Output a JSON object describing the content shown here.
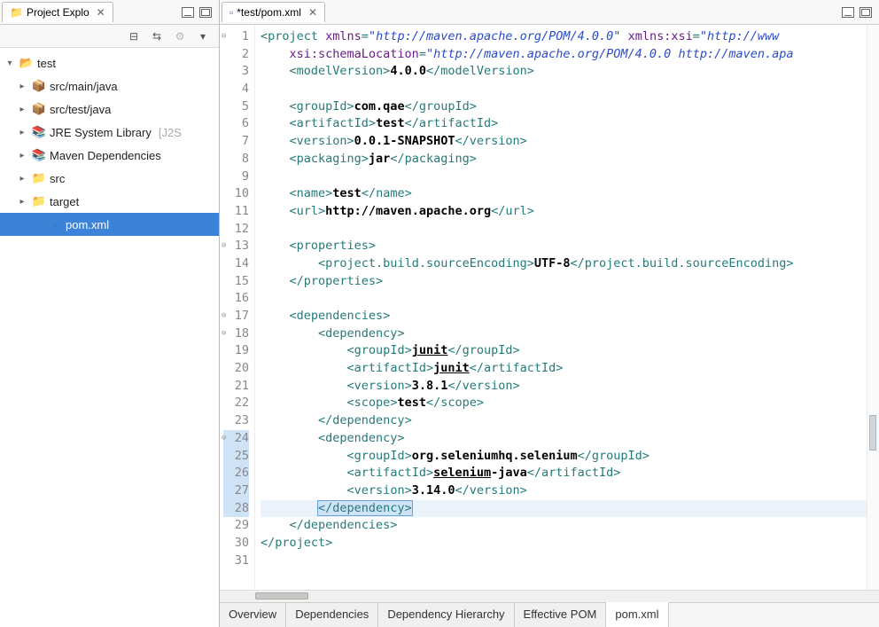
{
  "explorer": {
    "title": "Project Explo",
    "toolbar": [
      "collapse-all-icon",
      "link-icon",
      "filter-icon",
      "menu-icon"
    ],
    "tree": [
      {
        "depth": 0,
        "exp": "▾",
        "icon": "proj",
        "label": "test"
      },
      {
        "depth": 1,
        "exp": "▸",
        "icon": "pkg",
        "label": "src/main/java"
      },
      {
        "depth": 1,
        "exp": "▸",
        "icon": "pkg",
        "label": "src/test/java"
      },
      {
        "depth": 1,
        "exp": "▸",
        "icon": "lib",
        "label": "JRE System Library",
        "extra": "[J2S"
      },
      {
        "depth": 1,
        "exp": "▸",
        "icon": "lib",
        "label": "Maven Dependencies"
      },
      {
        "depth": 1,
        "exp": "▸",
        "icon": "folder",
        "label": "src"
      },
      {
        "depth": 1,
        "exp": "▸",
        "icon": "folder",
        "label": "target"
      },
      {
        "depth": 2,
        "exp": "",
        "icon": "file",
        "label": "pom.xml",
        "selected": true
      }
    ]
  },
  "editor": {
    "tab_title": "*test/pom.xml",
    "lines": [
      {
        "n": 1,
        "fold": true,
        "segs": [
          [
            "t-tag",
            "<project "
          ],
          [
            "t-attr",
            "xmlns"
          ],
          [
            "t-tag",
            "="
          ],
          [
            "t-str",
            "\"http://maven.apache.org/POM/4.0.0\""
          ],
          [
            "t-tag",
            " "
          ],
          [
            "t-attr",
            "xmlns:xsi"
          ],
          [
            "t-tag",
            "="
          ],
          [
            "t-str",
            "\"http://www"
          ]
        ]
      },
      {
        "n": 2,
        "segs": [
          [
            "",
            "    "
          ],
          [
            "t-attr",
            "xsi:schemaLocation"
          ],
          [
            "t-tag",
            "="
          ],
          [
            "t-str",
            "\"http://maven.apache.org/POM/4.0.0 http://maven.apa"
          ]
        ]
      },
      {
        "n": 3,
        "segs": [
          [
            "",
            "    "
          ],
          [
            "t-tag",
            "<modelVersion>"
          ],
          [
            "t-text",
            "4.0.0"
          ],
          [
            "t-tag",
            "</modelVersion>"
          ]
        ]
      },
      {
        "n": 4,
        "segs": [
          [
            "",
            ""
          ]
        ]
      },
      {
        "n": 5,
        "segs": [
          [
            "",
            "    "
          ],
          [
            "t-tag",
            "<groupId>"
          ],
          [
            "t-text",
            "com.qae"
          ],
          [
            "t-tag",
            "</groupId>"
          ]
        ]
      },
      {
        "n": 6,
        "segs": [
          [
            "",
            "    "
          ],
          [
            "t-tag",
            "<artifactId>"
          ],
          [
            "t-text",
            "test"
          ],
          [
            "t-tag",
            "</artifactId>"
          ]
        ]
      },
      {
        "n": 7,
        "segs": [
          [
            "",
            "    "
          ],
          [
            "t-tag",
            "<version>"
          ],
          [
            "t-text",
            "0.0.1-SNAPSHOT"
          ],
          [
            "t-tag",
            "</version>"
          ]
        ]
      },
      {
        "n": 8,
        "segs": [
          [
            "",
            "    "
          ],
          [
            "t-tag",
            "<packaging>"
          ],
          [
            "t-text",
            "jar"
          ],
          [
            "t-tag",
            "</packaging>"
          ]
        ]
      },
      {
        "n": 9,
        "segs": [
          [
            "",
            ""
          ]
        ]
      },
      {
        "n": 10,
        "segs": [
          [
            "",
            "    "
          ],
          [
            "t-tag",
            "<name>"
          ],
          [
            "t-text",
            "test"
          ],
          [
            "t-tag",
            "</name>"
          ]
        ]
      },
      {
        "n": 11,
        "segs": [
          [
            "",
            "    "
          ],
          [
            "t-tag",
            "<url>"
          ],
          [
            "t-text",
            "http://maven.apache.org"
          ],
          [
            "t-tag",
            "</url>"
          ]
        ]
      },
      {
        "n": 12,
        "segs": [
          [
            "",
            ""
          ]
        ]
      },
      {
        "n": 13,
        "fold": true,
        "segs": [
          [
            "",
            "    "
          ],
          [
            "t-tag",
            "<properties>"
          ]
        ]
      },
      {
        "n": 14,
        "segs": [
          [
            "",
            "        "
          ],
          [
            "t-tag",
            "<project.build.sourceEncoding>"
          ],
          [
            "t-text",
            "UTF-8"
          ],
          [
            "t-tag",
            "</project.build.sourceEncoding>"
          ]
        ]
      },
      {
        "n": 15,
        "segs": [
          [
            "",
            "    "
          ],
          [
            "t-tag",
            "</properties>"
          ]
        ]
      },
      {
        "n": 16,
        "segs": [
          [
            "",
            ""
          ]
        ]
      },
      {
        "n": 17,
        "fold": true,
        "segs": [
          [
            "",
            "    "
          ],
          [
            "t-tag",
            "<dependencies>"
          ]
        ]
      },
      {
        "n": 18,
        "fold": true,
        "segs": [
          [
            "",
            "        "
          ],
          [
            "t-tag",
            "<dependency>"
          ]
        ]
      },
      {
        "n": 19,
        "segs": [
          [
            "",
            "            "
          ],
          [
            "t-tag",
            "<groupId>"
          ],
          [
            "t-link",
            "junit"
          ],
          [
            "t-tag",
            "</groupId>"
          ]
        ]
      },
      {
        "n": 20,
        "segs": [
          [
            "",
            "            "
          ],
          [
            "t-tag",
            "<artifactId>"
          ],
          [
            "t-link",
            "junit"
          ],
          [
            "t-tag",
            "</artifactId>"
          ]
        ]
      },
      {
        "n": 21,
        "segs": [
          [
            "",
            "            "
          ],
          [
            "t-tag",
            "<version>"
          ],
          [
            "t-text",
            "3.8.1"
          ],
          [
            "t-tag",
            "</version>"
          ]
        ]
      },
      {
        "n": 22,
        "segs": [
          [
            "",
            "            "
          ],
          [
            "t-tag",
            "<scope>"
          ],
          [
            "t-text",
            "test"
          ],
          [
            "t-tag",
            "</scope>"
          ]
        ]
      },
      {
        "n": 23,
        "segs": [
          [
            "",
            "        "
          ],
          [
            "t-tag",
            "</dependency>"
          ]
        ]
      },
      {
        "n": 24,
        "fold": true,
        "hl": true,
        "segs": [
          [
            "",
            "        "
          ],
          [
            "t-tag",
            "<dependency>"
          ]
        ]
      },
      {
        "n": 25,
        "hl": true,
        "segs": [
          [
            "",
            "            "
          ],
          [
            "t-tag",
            "<groupId>"
          ],
          [
            "t-text",
            "org.seleniumhq.selenium"
          ],
          [
            "t-tag",
            "</groupId>"
          ]
        ]
      },
      {
        "n": 26,
        "hl": true,
        "segs": [
          [
            "",
            "            "
          ],
          [
            "t-tag",
            "<artifactId>"
          ],
          [
            "t-link",
            "selenium"
          ],
          [
            "t-text",
            "-java"
          ],
          [
            "t-tag",
            "</artifactId>"
          ]
        ]
      },
      {
        "n": 27,
        "hl": true,
        "segs": [
          [
            "",
            "            "
          ],
          [
            "t-tag",
            "<version>"
          ],
          [
            "t-text",
            "3.14.0"
          ],
          [
            "t-tag",
            "</version>"
          ]
        ]
      },
      {
        "n": 28,
        "hl": true,
        "cursor": true,
        "sel": true,
        "segs": [
          [
            "",
            "        "
          ],
          [
            "t-tag",
            "</dependency>"
          ]
        ]
      },
      {
        "n": 29,
        "segs": [
          [
            "",
            "    "
          ],
          [
            "t-tag",
            "</dependencies>"
          ]
        ]
      },
      {
        "n": 30,
        "segs": [
          [
            "t-tag",
            "</project>"
          ]
        ]
      },
      {
        "n": 31,
        "segs": [
          [
            "",
            ""
          ]
        ]
      }
    ],
    "bottom_tabs": [
      "Overview",
      "Dependencies",
      "Dependency Hierarchy",
      "Effective POM",
      "pom.xml"
    ],
    "active_bottom_tab": 4
  }
}
